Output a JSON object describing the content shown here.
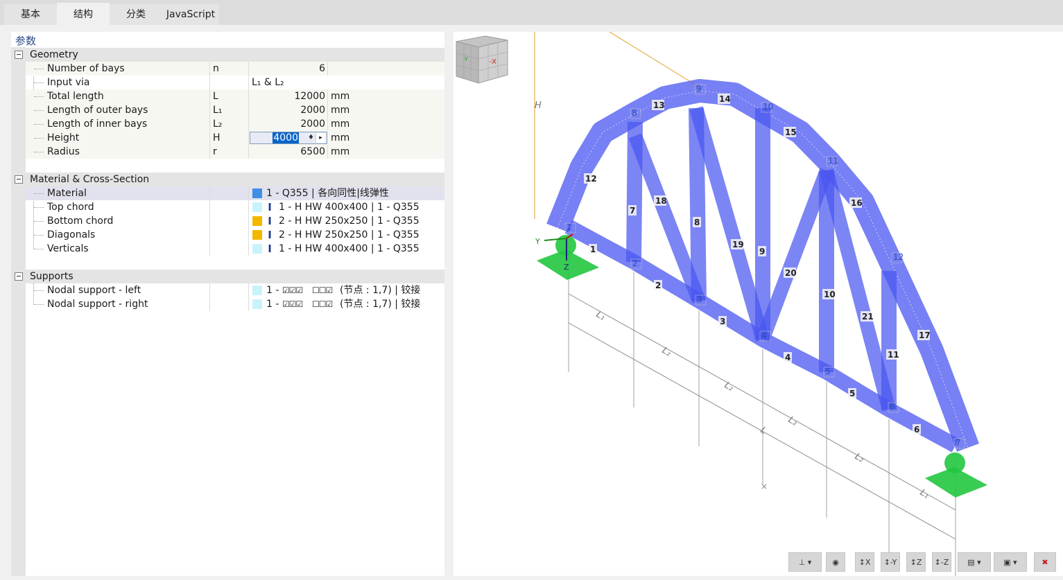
{
  "tabs": [
    {
      "label": "基本"
    },
    {
      "label": "结构"
    },
    {
      "label": "分类"
    },
    {
      "label": "JavaScript"
    }
  ],
  "panel": {
    "title": "参数",
    "geometry": {
      "header": "Geometry",
      "rows": [
        {
          "name": "Number of bays",
          "symbol": "n",
          "value": "6",
          "unit": ""
        },
        {
          "name": "Input via",
          "symbol": "",
          "value": "L₁ & L₂",
          "unit": ""
        },
        {
          "name": "Total length",
          "symbol": "L",
          "value": "12000",
          "unit": "mm"
        },
        {
          "name": "Length of outer bays",
          "symbol": "L₁",
          "value": "2000",
          "unit": "mm"
        },
        {
          "name": "Length of inner bays",
          "symbol": "L₂",
          "value": "2000",
          "unit": "mm"
        },
        {
          "name": "Height",
          "symbol": "H",
          "value": "4000",
          "unit": "mm"
        },
        {
          "name": "Radius",
          "symbol": "r",
          "value": "6500",
          "unit": "mm"
        }
      ]
    },
    "material": {
      "header": "Material & Cross-Section",
      "rows": [
        {
          "name": "Material",
          "text": "1 - Q355 | 各向同性|线弹性",
          "color": "#3f8fe6"
        },
        {
          "name": "Top chord",
          "text": "1 - H HW 400x400 | 1 - Q355",
          "color": "#c9f3fb"
        },
        {
          "name": "Bottom chord",
          "text": "2 - H HW 250x250 | 1 - Q355",
          "color": "#f2b800"
        },
        {
          "name": "Diagonals",
          "text": "2 - H HW 250x250 | 1 - Q355",
          "color": "#f2b800"
        },
        {
          "name": "Verticals",
          "text": "1 - H HW 400x400 | 1 - Q355",
          "color": "#c9f3fb"
        }
      ]
    },
    "supports": {
      "header": "Supports",
      "rows": [
        {
          "name": "Nodal support - left",
          "prefix": "1 -",
          "checks": "☑☑☑",
          "unchecked": "☐☐☑",
          "text": "(节点 : 1,7) | 铰接",
          "color": "#c9f3fb"
        },
        {
          "name": "Nodal support - right",
          "prefix": "1 -",
          "checks": "☑☑☑",
          "unchecked": "☐☐☑",
          "text": "(节点 : 1,7) | 铰接",
          "color": "#c9f3fb"
        }
      ]
    }
  },
  "viewport": {
    "axis_labels": {
      "y": "Y",
      "z": "Z"
    },
    "dim_labels": [
      "L₁",
      "L₂",
      "L₂",
      "L₂",
      "L₂",
      "L₁",
      "L",
      "H"
    ],
    "node_labels": [
      "1",
      "2",
      "3",
      "4",
      "5",
      "6",
      "7",
      "8",
      "9",
      "10",
      "11",
      "12"
    ],
    "member_labels": [
      "1",
      "2",
      "3",
      "4",
      "5",
      "6",
      "7",
      "8",
      "9",
      "10",
      "11",
      "12",
      "13",
      "14",
      "15",
      "16",
      "17",
      "18",
      "19",
      "20",
      "21"
    ],
    "navcube_labels": {
      "y": "-Y",
      "x": "-X"
    },
    "member_color": "#4a56f0",
    "support_color": "#22c640",
    "dim_color": "#8a8a8a",
    "height_dim_color": "#e0a020"
  },
  "toolbar": {
    "buttons": [
      {
        "name": "axes-view-icon",
        "label": "⊥ ▾"
      },
      {
        "name": "render-settings-icon",
        "label": "◉"
      },
      {
        "name": "view-x-icon",
        "label": "↕X"
      },
      {
        "name": "view-y-icon",
        "label": "↕-Y"
      },
      {
        "name": "view-z-icon",
        "label": "↕Z"
      },
      {
        "name": "view-minus-z-icon",
        "label": "↕-Z"
      },
      {
        "name": "display-mode-icon",
        "label": "▤ ▾"
      },
      {
        "name": "iso-view-icon",
        "label": "▣ ▾"
      },
      {
        "name": "reset-view-icon",
        "label": "✖"
      }
    ]
  }
}
